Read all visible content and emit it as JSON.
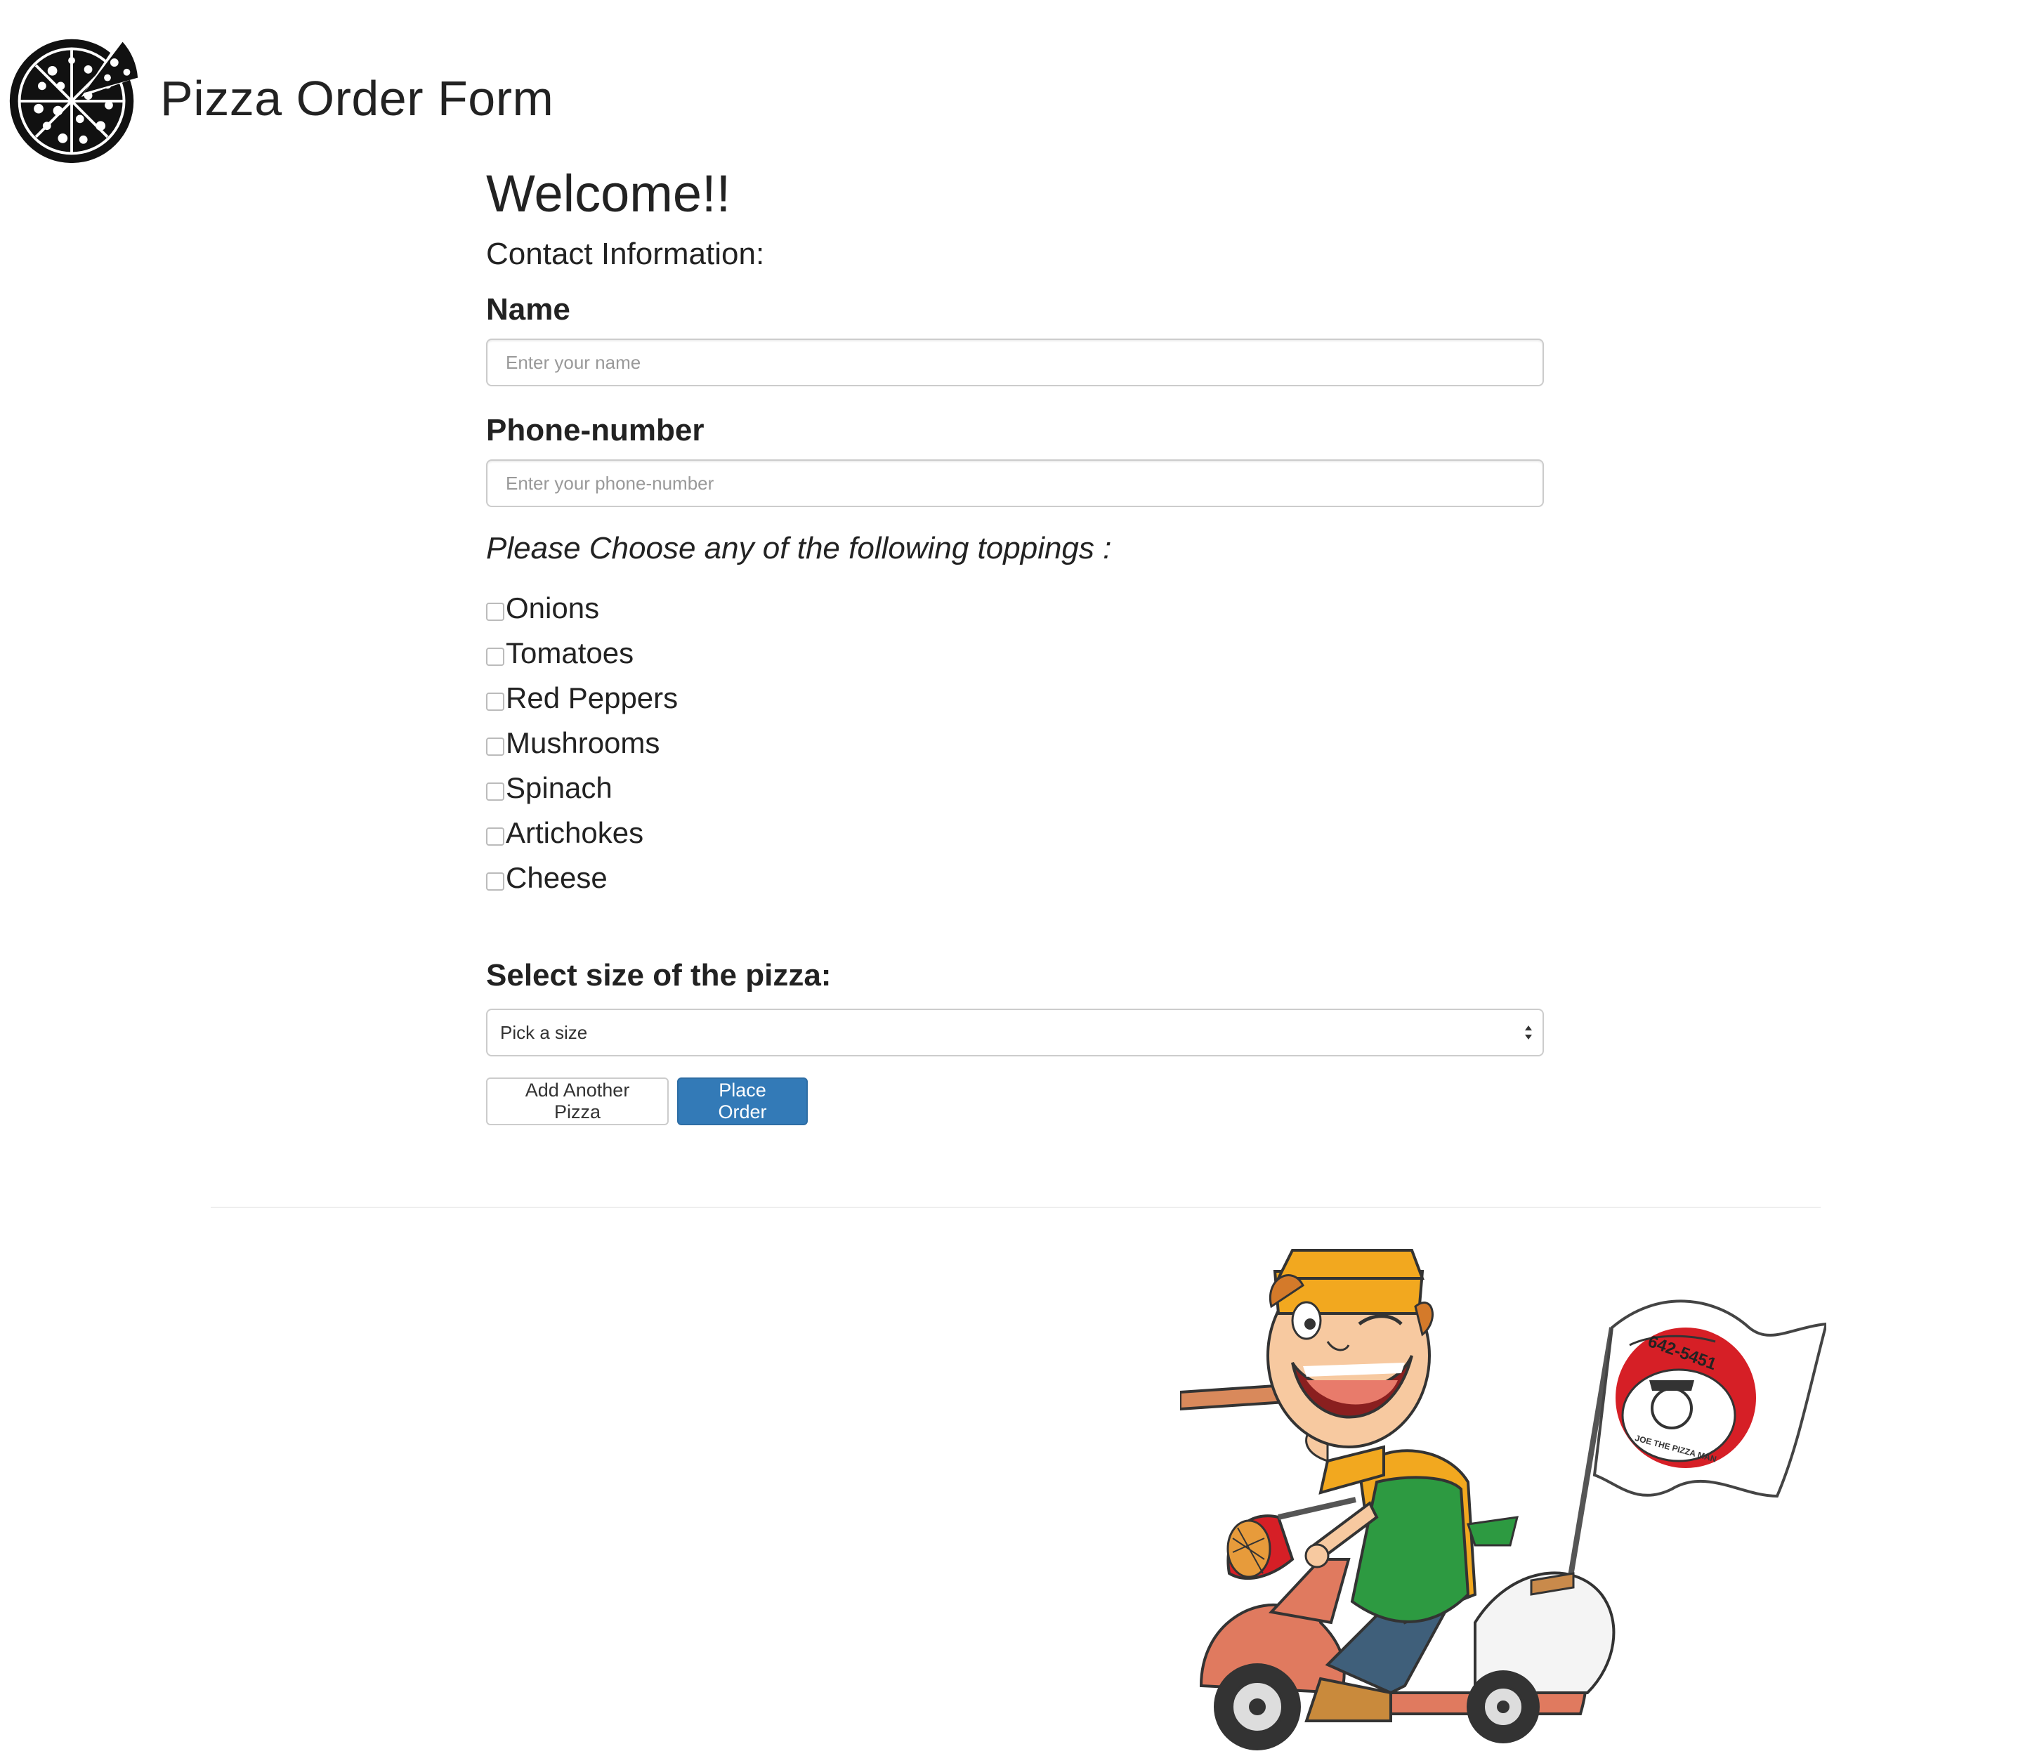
{
  "header": {
    "title": "Pizza Order Form",
    "logo_icon": "pizza-icon"
  },
  "form": {
    "welcome": "Welcome!!",
    "contact_heading": "Contact Information:",
    "name_label": "Name",
    "name_placeholder": "Enter your name",
    "phone_label": "Phone-number",
    "phone_placeholder": "Enter your phone-number",
    "toppings_prompt": "Please Choose any of the following toppings :",
    "toppings": [
      {
        "label": "Onions",
        "checked": false
      },
      {
        "label": "Tomatoes",
        "checked": false
      },
      {
        "label": "Red Peppers",
        "checked": false
      },
      {
        "label": "Mushrooms",
        "checked": false
      },
      {
        "label": "Spinach",
        "checked": false
      },
      {
        "label": "Artichokes",
        "checked": false
      },
      {
        "label": "Cheese",
        "checked": false
      }
    ],
    "size_label": "Select size of the pizza:",
    "size_selected": "Pick a size",
    "add_button": "Add Another Pizza",
    "order_button": "Place Order"
  },
  "illustration": {
    "flag_phone": "642-5451",
    "flag_tagline": "JOE THE PIZZA MAN"
  },
  "colors": {
    "primary_button": "#337ab7",
    "input_border": "#cccccc",
    "text": "#222222"
  }
}
